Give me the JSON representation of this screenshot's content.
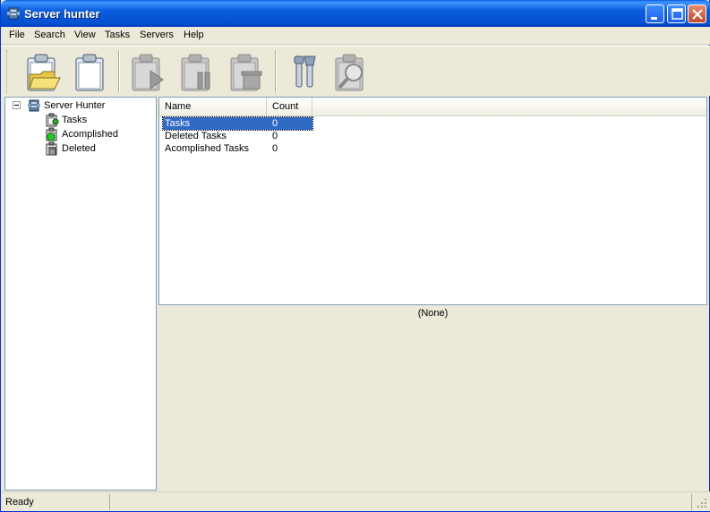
{
  "window": {
    "title": "Server hunter"
  },
  "menu": [
    "File",
    "Search",
    "View",
    "Tasks",
    "Servers",
    "Help"
  ],
  "toolbar": {
    "buttons": [
      {
        "icon": "open-clipboard-icon",
        "enabled": true
      },
      {
        "icon": "new-clipboard-icon",
        "enabled": true
      },
      {
        "icon": "start-task-icon",
        "enabled": false
      },
      {
        "icon": "pause-task-icon",
        "enabled": false
      },
      {
        "icon": "delete-task-icon",
        "enabled": false
      },
      {
        "icon": "tools-icon",
        "enabled": true
      },
      {
        "icon": "search-task-icon",
        "enabled": false
      }
    ]
  },
  "tree": {
    "root": "Server Hunter",
    "children": [
      "Tasks",
      "Acomplished",
      "Deleted"
    ]
  },
  "list": {
    "columns": [
      "Name",
      "Count"
    ],
    "rows": [
      {
        "name": "Tasks",
        "count": "0",
        "selected": true
      },
      {
        "name": "Deleted Tasks",
        "count": "0",
        "selected": false
      },
      {
        "name": "Acomplished Tasks",
        "count": "0",
        "selected": false
      }
    ]
  },
  "detail": {
    "label": "(None)"
  },
  "status": {
    "text": "Ready"
  }
}
